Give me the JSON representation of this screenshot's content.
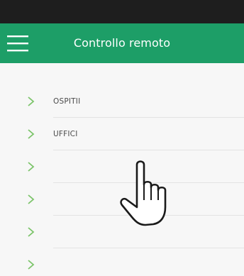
{
  "app_bar": {
    "title": "Controllo remoto",
    "menu_icon": "hamburger-menu-icon",
    "background_color": "#1d9e67",
    "title_color": "#ffffff"
  },
  "status_bar": {
    "background_color": "#1e1e1e"
  },
  "list": {
    "chevron_icon": "chevron-right-icon",
    "chevron_color": "#7cc46a",
    "items": [
      {
        "label": "OSPITII"
      },
      {
        "label": "UFFICI"
      },
      {
        "label": ""
      },
      {
        "label": ""
      },
      {
        "label": ""
      },
      {
        "label": ""
      }
    ]
  },
  "overlay": {
    "cursor_icon": "hand-pointer-icon"
  }
}
